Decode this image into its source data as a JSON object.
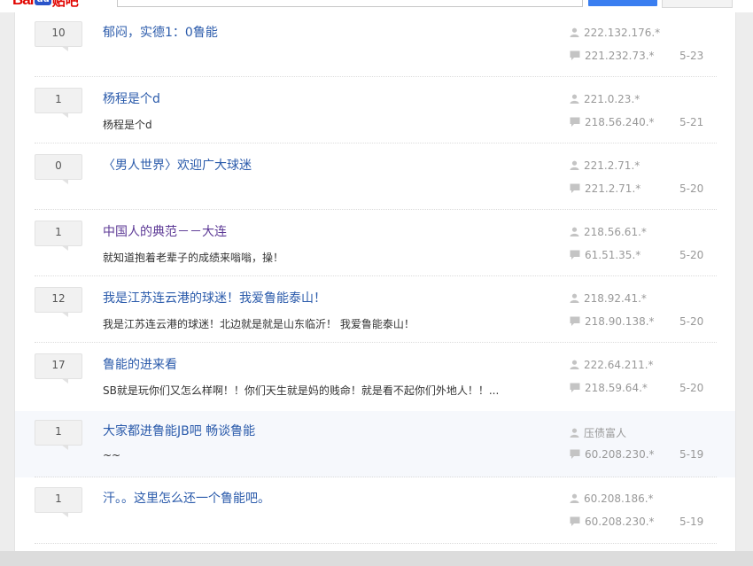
{
  "header": {
    "logo_bai": "Bai",
    "logo_du": "du",
    "logo_zhi": "贴吧"
  },
  "icons": {
    "author": "person-icon",
    "last_reply": "comment-icon"
  },
  "colors": {
    "link": "#2b5bab",
    "visited": "#5d3a96",
    "meta": "#999999"
  },
  "threads": [
    {
      "replies": "10",
      "title": "郁闷，实德1：0鲁能",
      "abstract": "",
      "author": "222.132.176.*",
      "last_replier": "221.232.73.*",
      "date": "5-23"
    },
    {
      "replies": "1",
      "title": "杨程是个d",
      "abstract": "杨程是个d",
      "author": "221.0.23.*",
      "last_replier": "218.56.240.*",
      "date": "5-21"
    },
    {
      "replies": "0",
      "title": "〈男人世界〉欢迎广大球迷",
      "abstract": "",
      "author": "221.2.71.*",
      "last_replier": "221.2.71.*",
      "date": "5-20"
    },
    {
      "replies": "1",
      "title": "中国人的典范－－大连",
      "abstract": "就知道抱着老辈子的成绩来嗡嗡，操！",
      "author": "218.56.61.*",
      "last_replier": "61.51.35.*",
      "date": "5-20"
    },
    {
      "replies": "12",
      "title": "我是江苏连云港的球迷！我爱鲁能泰山！",
      "abstract": "我是江苏连云港的球迷！北边就是就是山东临沂！  我爱鲁能泰山！",
      "author": "218.92.41.*",
      "last_replier": "218.90.138.*",
      "date": "5-20"
    },
    {
      "replies": "17",
      "title": "鲁能的进来看",
      "abstract": "SB就是玩你们又怎么样啊！！你们天生就是妈的贱命！就是看不起你们外地人！！...",
      "author": "222.64.211.*",
      "last_replier": "218.59.64.*",
      "date": "5-20"
    },
    {
      "replies": "1",
      "title": "大家都进鲁能JB吧 畅谈鲁能",
      "abstract": "~~",
      "author": "压债富人",
      "last_replier": "60.208.230.*",
      "date": "5-19"
    },
    {
      "replies": "1",
      "title": "汗。。这里怎么还一个鲁能吧。",
      "abstract": "",
      "author": "60.208.186.*",
      "last_replier": "60.208.230.*",
      "date": "5-19"
    }
  ]
}
